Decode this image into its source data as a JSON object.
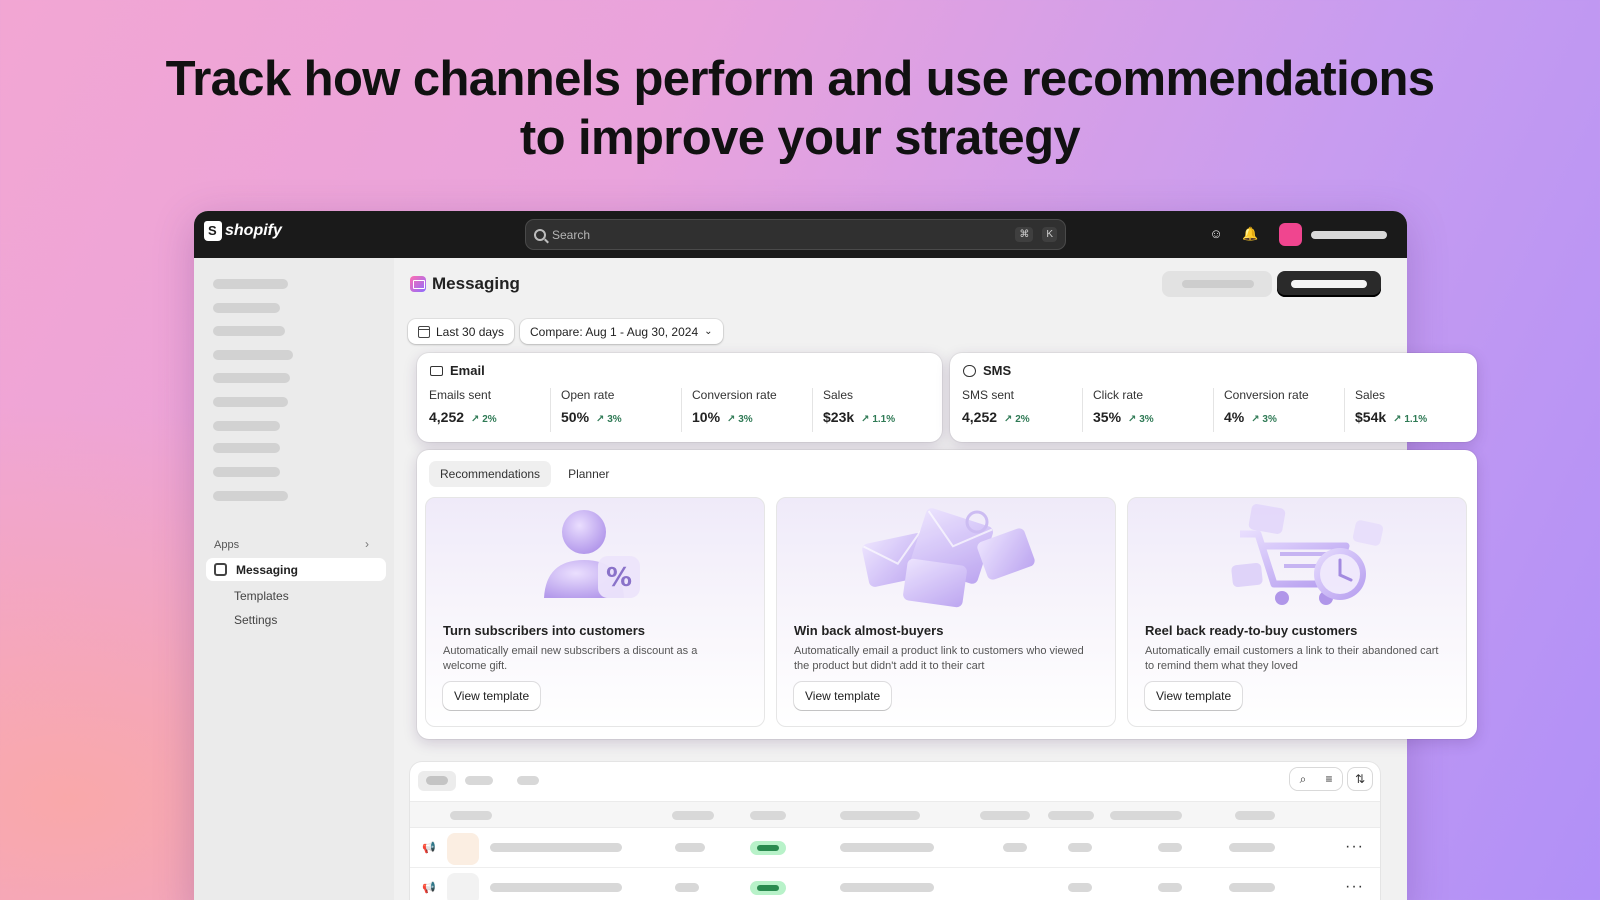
{
  "headline": {
    "line1": "Track how channels perform and use recommendations",
    "line2": "to improve your strategy"
  },
  "topbar": {
    "logo_text": "shopify",
    "search_placeholder": "Search",
    "shortcut_mod": "⌘",
    "shortcut_key": "K"
  },
  "sidebar": {
    "apps_label": "Apps",
    "active_item": "Messaging",
    "subitems": [
      "Templates",
      "Settings"
    ]
  },
  "page": {
    "title": "Messaging"
  },
  "filters": {
    "date_range": "Last 30 days",
    "compare": "Compare: Aug 1 - Aug 30, 2024"
  },
  "email": {
    "title": "Email",
    "metrics": [
      {
        "label": "Emails sent",
        "value": "4,252",
        "delta": "2%"
      },
      {
        "label": "Open rate",
        "value": "50%",
        "delta": "3%"
      },
      {
        "label": "Conversion rate",
        "value": "10%",
        "delta": "3%"
      },
      {
        "label": "Sales",
        "value": "$23k",
        "delta": "1.1%"
      }
    ]
  },
  "sms": {
    "title": "SMS",
    "metrics": [
      {
        "label": "SMS sent",
        "value": "4,252",
        "delta": "2%"
      },
      {
        "label": "Click rate",
        "value": "35%",
        "delta": "3%"
      },
      {
        "label": "Conversion rate",
        "value": "4%",
        "delta": "3%"
      },
      {
        "label": "Sales",
        "value": "$54k",
        "delta": "1.1%"
      }
    ]
  },
  "tabs": [
    "Recommendations",
    "Planner"
  ],
  "recommendations": [
    {
      "title": "Turn subscribers into customers",
      "description": "Automatically email new subscribers a discount as a welcome gift.",
      "button": "View template"
    },
    {
      "title": "Win back almost-buyers",
      "description": "Automatically email a product link to customers who viewed the product but didn't add it to their cart",
      "button": "View template"
    },
    {
      "title": "Reel back ready-to-buy customers",
      "description": "Automatically email customers a link to their abandoned cart to remind them what they loved",
      "button": "View template"
    }
  ],
  "colors": {
    "accent_pink": "#f0458f",
    "delta_green": "#2f7a55",
    "status_green": "#b8f2c9"
  }
}
